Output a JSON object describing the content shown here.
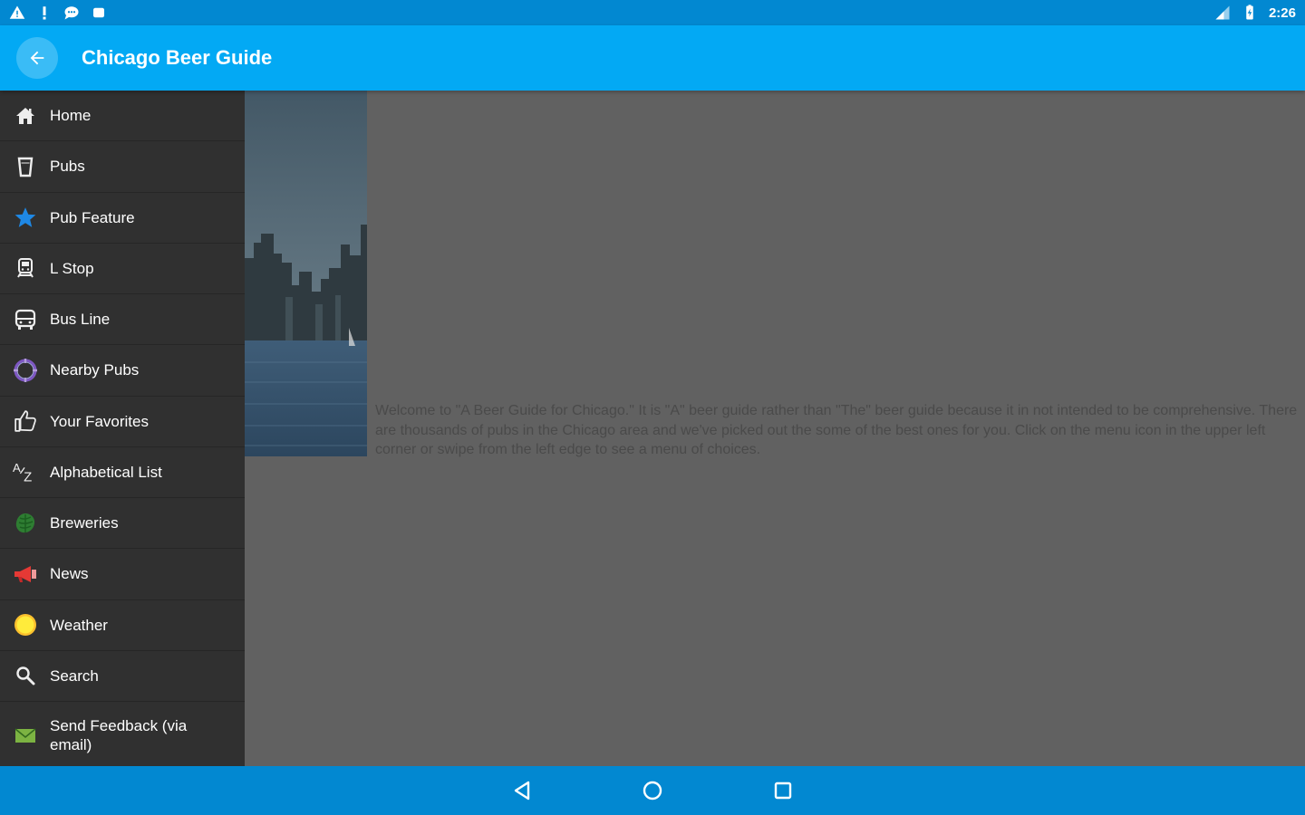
{
  "status_bar": {
    "time": "2:26",
    "left_icons": [
      "warning-icon",
      "alert-icon",
      "chat-icon",
      "android-icon"
    ],
    "right_icons": [
      "signal-icon",
      "battery-icon"
    ]
  },
  "app_bar": {
    "title": "Chicago Beer Guide",
    "back_icon": "back-arrow-icon"
  },
  "drawer": {
    "items": [
      {
        "label": "Home",
        "icon": "home-icon"
      },
      {
        "label": "Pubs",
        "icon": "pint-glass-icon"
      },
      {
        "label": "Pub Feature",
        "icon": "star-icon"
      },
      {
        "label": "L Stop",
        "icon": "train-icon"
      },
      {
        "label": "Bus Line",
        "icon": "bus-icon"
      },
      {
        "label": "Nearby Pubs",
        "icon": "location-target-icon"
      },
      {
        "label": "Your Favorites",
        "icon": "thumbs-up-icon"
      },
      {
        "label": "Alphabetical List",
        "icon": "a-z-icon"
      },
      {
        "label": "Breweries",
        "icon": "hops-icon"
      },
      {
        "label": "News",
        "icon": "megaphone-icon"
      },
      {
        "label": "Weather",
        "icon": "sun-icon"
      },
      {
        "label": "Search",
        "icon": "search-icon"
      },
      {
        "label": "Send Feedback (via email)",
        "icon": "email-icon"
      }
    ]
  },
  "content": {
    "welcome_text": "Welcome to \"A Beer Guide for Chicago.\" It is \"A\" beer guide rather than \"The\" beer guide because it in not intended to be comprehensive. There are thousands of pubs in the Chicago area and we've picked out the some of the best ones for you. Click on the menu icon in the upper left corner or swipe from the left edge to see a menu of choices."
  },
  "nav_bar": {
    "buttons": [
      "back-triangle-icon",
      "home-circle-icon",
      "recents-square-icon"
    ]
  },
  "colors": {
    "status_bar": "#0288d1",
    "app_bar": "#03a9f4",
    "drawer": "#303030",
    "content": "#616161"
  }
}
